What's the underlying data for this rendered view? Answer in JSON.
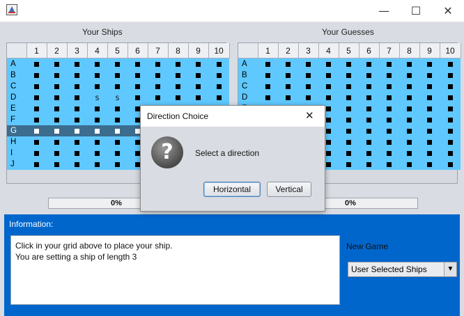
{
  "window": {
    "min": "—",
    "max": "☐",
    "close": "✕"
  },
  "left_grid": {
    "title": "Your Ships",
    "progress": "0%"
  },
  "right_grid": {
    "title": "Your Guesses",
    "progress": "0%"
  },
  "columns": [
    "1",
    "2",
    "3",
    "4",
    "5",
    "6",
    "7",
    "8",
    "9",
    "10"
  ],
  "rows": [
    "A",
    "B",
    "C",
    "D",
    "E",
    "F",
    "G",
    "H",
    "I",
    "J"
  ],
  "selected_row": "G",
  "ship_marks": {
    "D4": "S",
    "D5": "S"
  },
  "info": {
    "label": "Information:",
    "line1": "Click in your grid above to place your ship.",
    "line2": "You are setting a ship of length 3"
  },
  "new_game": {
    "label": "New Game",
    "selected": "User Selected Ships",
    "arrow": "▼"
  },
  "dialog": {
    "title": "Direction Choice",
    "close": "✕",
    "icon_glyph": "?",
    "message": "Select a direction",
    "horizontal": "Horizontal",
    "vertical": "Vertical"
  }
}
